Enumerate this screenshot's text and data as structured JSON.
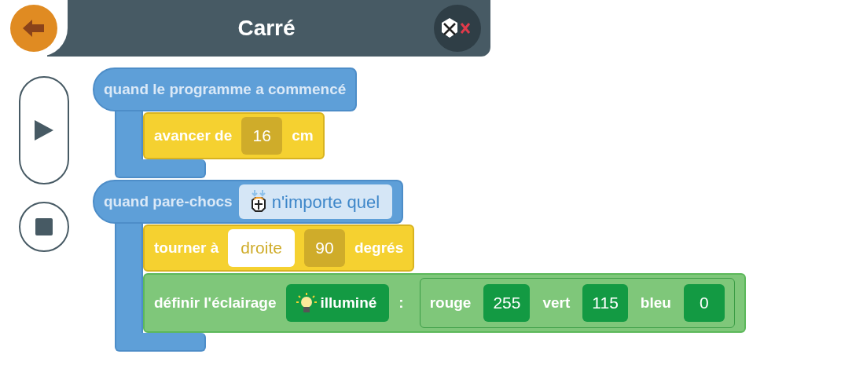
{
  "header": {
    "title": "Carré"
  },
  "controls": [
    {
      "kind": "play"
    },
    {
      "kind": "stop"
    }
  ],
  "scripts": [
    {
      "hat": [
        {
          "kind": "text",
          "text": "quand le programme a commencé"
        }
      ],
      "blocks": [
        {
          "kind": "motion",
          "parts": [
            {
              "kind": "text",
              "text": "avancer de"
            },
            {
              "kind": "number",
              "text": "16"
            },
            {
              "kind": "text",
              "text": "cm"
            }
          ]
        }
      ]
    },
    {
      "hat": [
        {
          "kind": "text",
          "text": "quand pare-chocs"
        },
        {
          "kind": "bumper",
          "text": "n'importe quel"
        }
      ],
      "blocks": [
        {
          "kind": "motion",
          "parts": [
            {
              "kind": "text",
              "text": "tourner à"
            },
            {
              "kind": "dropdown",
              "text": "droite"
            },
            {
              "kind": "number",
              "text": "90"
            },
            {
              "kind": "text",
              "text": "degrés"
            }
          ]
        },
        {
          "kind": "lights",
          "parts": [
            {
              "kind": "text",
              "text": "définir l'éclairage"
            },
            {
              "kind": "light",
              "text": "illuminé"
            },
            {
              "kind": "text",
              "text": ":"
            },
            {
              "kind": "group",
              "parts": [
                {
                  "kind": "text",
                  "text": "rouge"
                },
                {
                  "kind": "number",
                  "text": "255"
                },
                {
                  "kind": "text",
                  "text": "vert"
                },
                {
                  "kind": "number",
                  "text": "115"
                },
                {
                  "kind": "text",
                  "text": "bleu"
                },
                {
                  "kind": "number",
                  "text": "0"
                }
              ]
            }
          ]
        }
      ]
    }
  ]
}
